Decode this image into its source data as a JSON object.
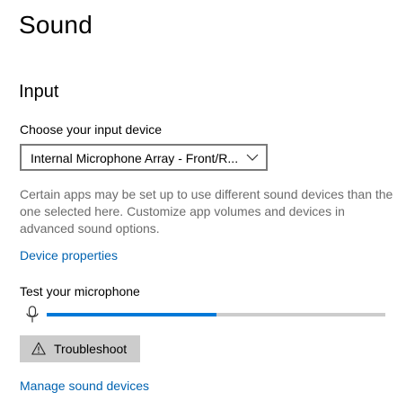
{
  "page": {
    "title": "Sound"
  },
  "input": {
    "section_title": "Input",
    "choose_label": "Choose your input device",
    "selected_device": "Internal Microphone Array - Front/R...",
    "help_text": "Certain apps may be set up to use different sound devices than the one selected here. Customize app volumes and devices in advanced sound options.",
    "device_properties_link": "Device properties",
    "test_label": "Test your microphone",
    "mic_level_percent": 50,
    "troubleshoot_label": "Troubleshoot",
    "manage_devices_link": "Manage sound devices"
  },
  "icons": {
    "dropdown": "chevron-down-icon",
    "microphone": "microphone-icon",
    "troubleshoot": "warning-icon"
  },
  "colors": {
    "accent": "#0078d7",
    "link": "#0063b1",
    "muted_text": "#6b6b6b",
    "button_bg": "#cccccc",
    "track": "#cccccc"
  }
}
